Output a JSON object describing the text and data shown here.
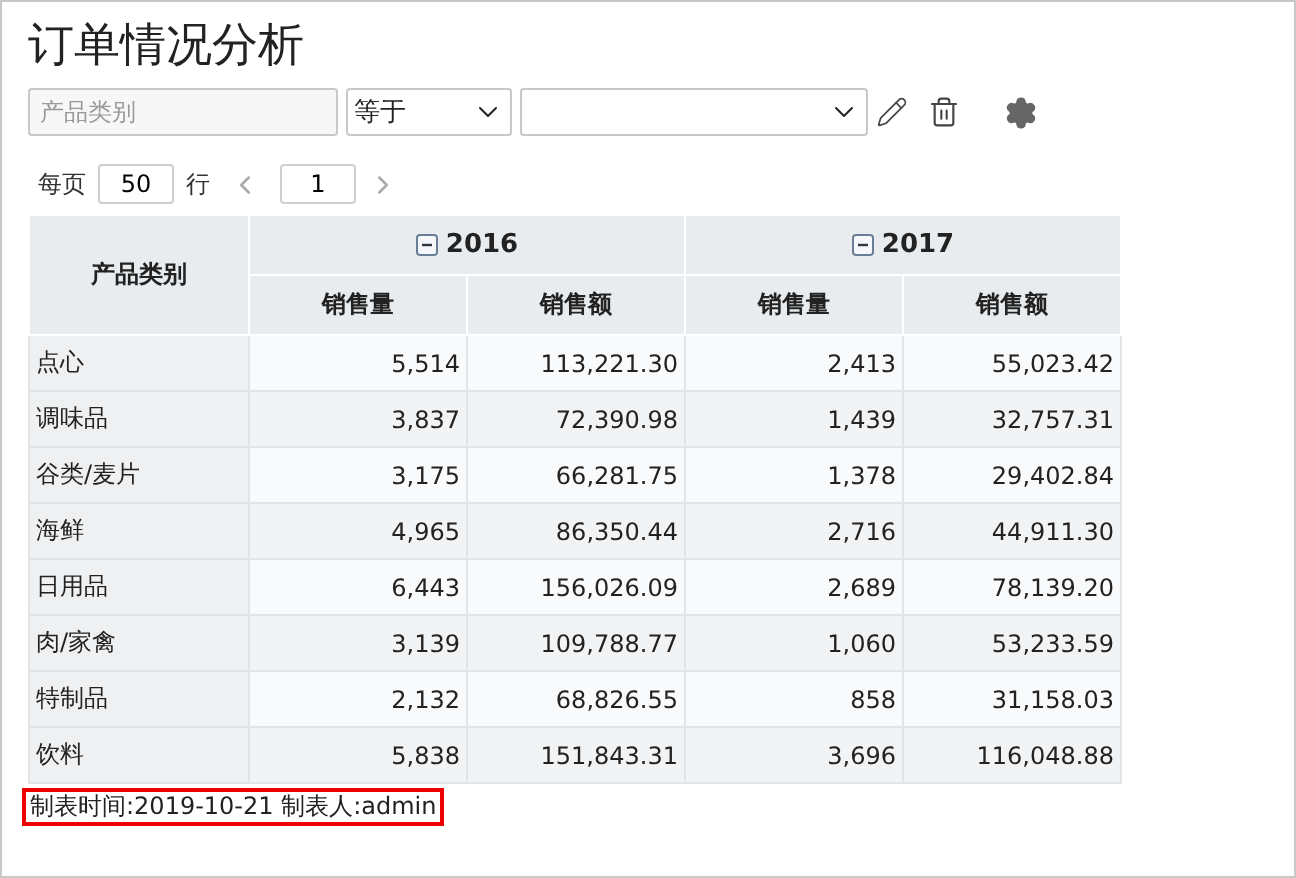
{
  "title": "订单情况分析",
  "filter": {
    "field_placeholder": "产品类别",
    "operator": "等于"
  },
  "pager": {
    "per_page_label": "每页",
    "per_page": "50",
    "rows_label": "行",
    "page": "1"
  },
  "table": {
    "corner": "产品类别",
    "groups": [
      {
        "label": "2016",
        "expanded": true,
        "columns": [
          "销售量",
          "销售额"
        ]
      },
      {
        "label": "2017",
        "expanded": true,
        "columns": [
          "销售量",
          "销售额"
        ]
      }
    ],
    "rows": [
      {
        "category": "点心",
        "values": [
          "5,514",
          "113,221.30",
          "2,413",
          "55,023.42"
        ]
      },
      {
        "category": "调味品",
        "values": [
          "3,837",
          "72,390.98",
          "1,439",
          "32,757.31"
        ]
      },
      {
        "category": "谷类/麦片",
        "values": [
          "3,175",
          "66,281.75",
          "1,378",
          "29,402.84"
        ]
      },
      {
        "category": "海鲜",
        "values": [
          "4,965",
          "86,350.44",
          "2,716",
          "44,911.30"
        ]
      },
      {
        "category": "日用品",
        "values": [
          "6,443",
          "156,026.09",
          "2,689",
          "78,139.20"
        ]
      },
      {
        "category": "肉/家禽",
        "values": [
          "3,139",
          "109,788.77",
          "1,060",
          "53,233.59"
        ]
      },
      {
        "category": "特制品",
        "values": [
          "2,132",
          "68,826.55",
          "858",
          "31,158.03"
        ]
      },
      {
        "category": "饮料",
        "values": [
          "5,838",
          "151,843.31",
          "3,696",
          "116,048.88"
        ]
      }
    ]
  },
  "footer": "制表时间:2019-10-21 制表人:admin"
}
